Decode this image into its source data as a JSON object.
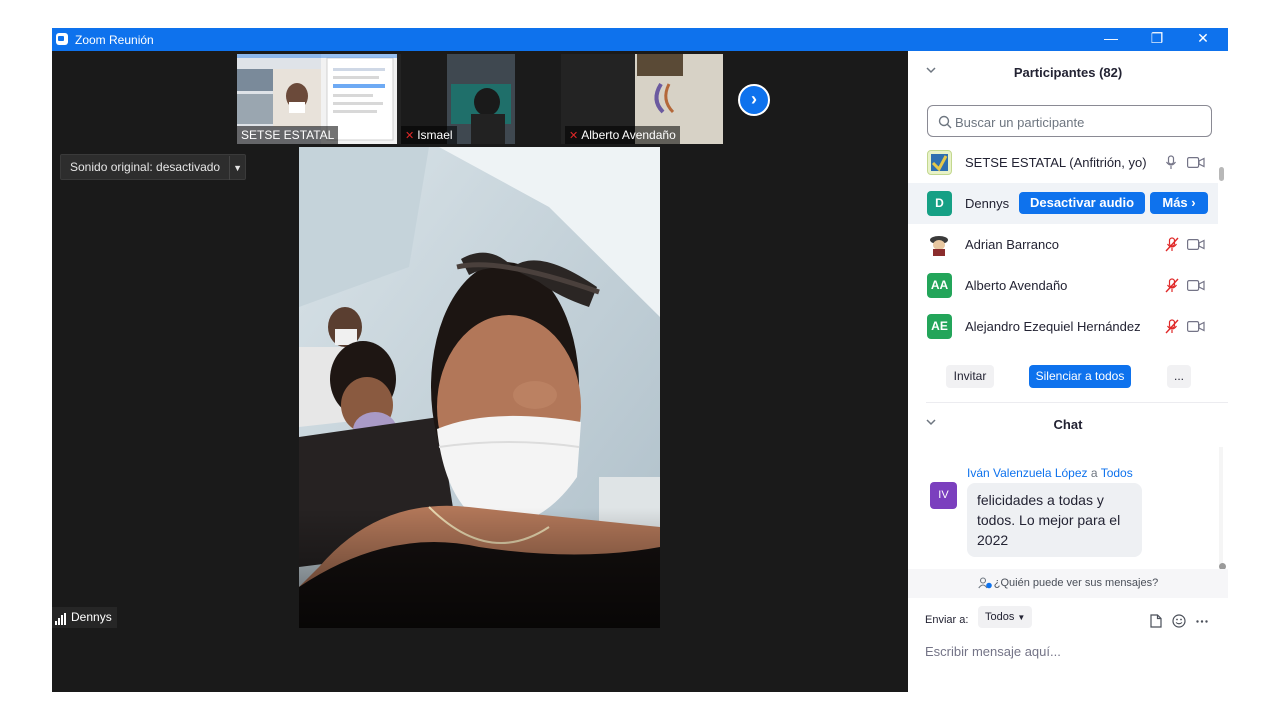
{
  "window": {
    "title": "Zoom Reunión"
  },
  "title_controls": {
    "minimize": "—",
    "restore": "❐",
    "close": "✕"
  },
  "thumbnails": [
    {
      "name": "SETSE ESTATAL",
      "muted": false
    },
    {
      "name": "Ismael",
      "muted": true
    },
    {
      "name": "Alberto Avendaño",
      "muted": true
    }
  ],
  "next_page_icon": "chevron-right-icon",
  "sound_button": {
    "label": "Sonido original: desactivado",
    "dropdown": "▼"
  },
  "active_speaker": {
    "name": "Dennys"
  },
  "participants": {
    "header": "Participantes (82)",
    "search_placeholder": "Buscar un participante",
    "items": [
      {
        "name": "SETSE ESTATAL (Anfitrión, yo)",
        "avatar": "",
        "avatar_color": "#d4e9a8",
        "mic": "on",
        "cam": "off"
      },
      {
        "name": "Dennys",
        "avatar": "D",
        "avatar_color": "#16a085",
        "unmute_label": "Desactivar audio",
        "more_label": "Más ›"
      },
      {
        "name": "Adrian Barranco",
        "avatar": "",
        "avatar_color": "#ffffff",
        "mic": "muted",
        "cam": "off"
      },
      {
        "name": "Alberto Avendaño",
        "avatar": "AA",
        "avatar_color": "#23a55a",
        "mic": "muted",
        "cam": "off"
      },
      {
        "name": "Alejandro Ezequiel Hernández",
        "avatar": "AE",
        "avatar_color": "#23a55a",
        "mic": "muted",
        "cam": "off"
      }
    ],
    "invite_label": "Invitar",
    "mute_all_label": "Silenciar a todos",
    "more_label": "..."
  },
  "chat": {
    "header": "Chat",
    "messages": [
      {
        "sender": "Iván Valenzuela López",
        "connector": "a",
        "recipient": "Todos",
        "avatar": "IV",
        "text": "felicidades a todas y todos. Lo mejor para el 2022"
      }
    ],
    "who_can_see": "¿Quién puede ver sus mensajes?",
    "send_to_label": "Enviar a:",
    "send_to_value": "Todos",
    "input_placeholder": "Escribir mensaje aquí..."
  },
  "colors": {
    "accent": "#0e72ed",
    "titlebar": "#0e72ed",
    "video_bg": "#1a1a1a",
    "muted_red": "#e02828"
  }
}
